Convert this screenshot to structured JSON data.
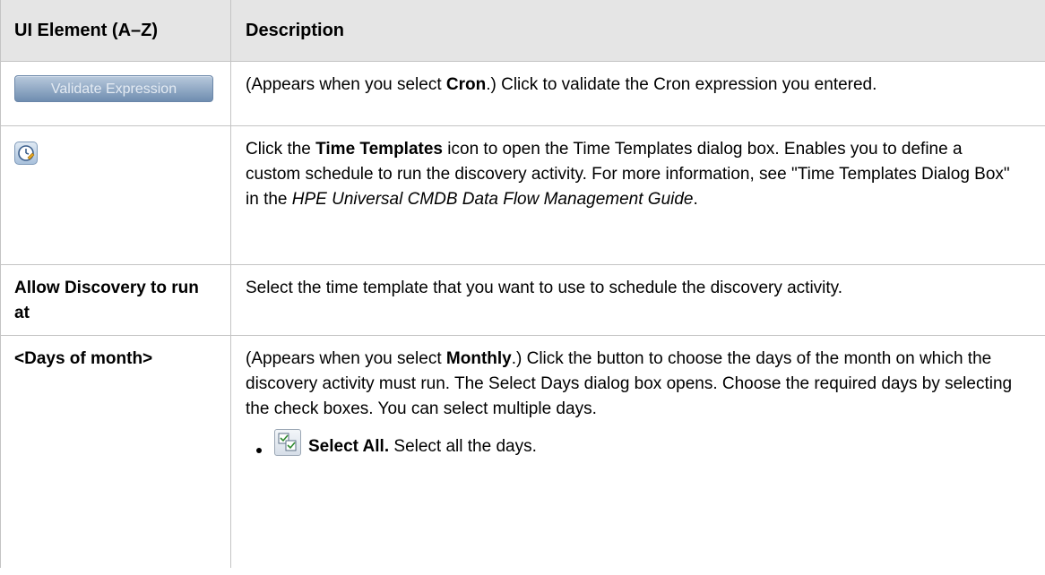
{
  "table": {
    "header": {
      "element": "UI Element (A–Z)",
      "description": "Description"
    },
    "rows": {
      "validate": {
        "button_label": "Validate Expression",
        "desc_prefix": "(Appears when you select ",
        "desc_bold": "Cron",
        "desc_suffix": ".) Click to validate the Cron expression you entered."
      },
      "time_templates": {
        "icon": "time-templates-icon",
        "desc_prefix": "Click the ",
        "desc_bold": "Time Templates",
        "desc_middle": " icon to open the Time Templates dialog box. Enables you to define a custom schedule to run the discovery activity. For more information, see \"Time Templates Dialog Box\" in the ",
        "desc_italic": "HPE Universal CMDB Data Flow Management Guide",
        "desc_suffix": "."
      },
      "allow": {
        "element": "Allow Discovery to run at",
        "description": "Select the time template that you want to use to schedule the discovery activity."
      },
      "days": {
        "element": "<Days of month>",
        "desc_prefix": "(Appears when you select ",
        "desc_bold": "Monthly",
        "desc_suffix": ".) Click the button to choose the days of the month on which the discovery activity must run. The Select Days dialog box opens. Choose the required days by selecting the check boxes. You can select multiple days.",
        "bullet_icon": "select-all-icon",
        "bullet_bold": "Select All.",
        "bullet_text": " Select all the days."
      }
    }
  }
}
